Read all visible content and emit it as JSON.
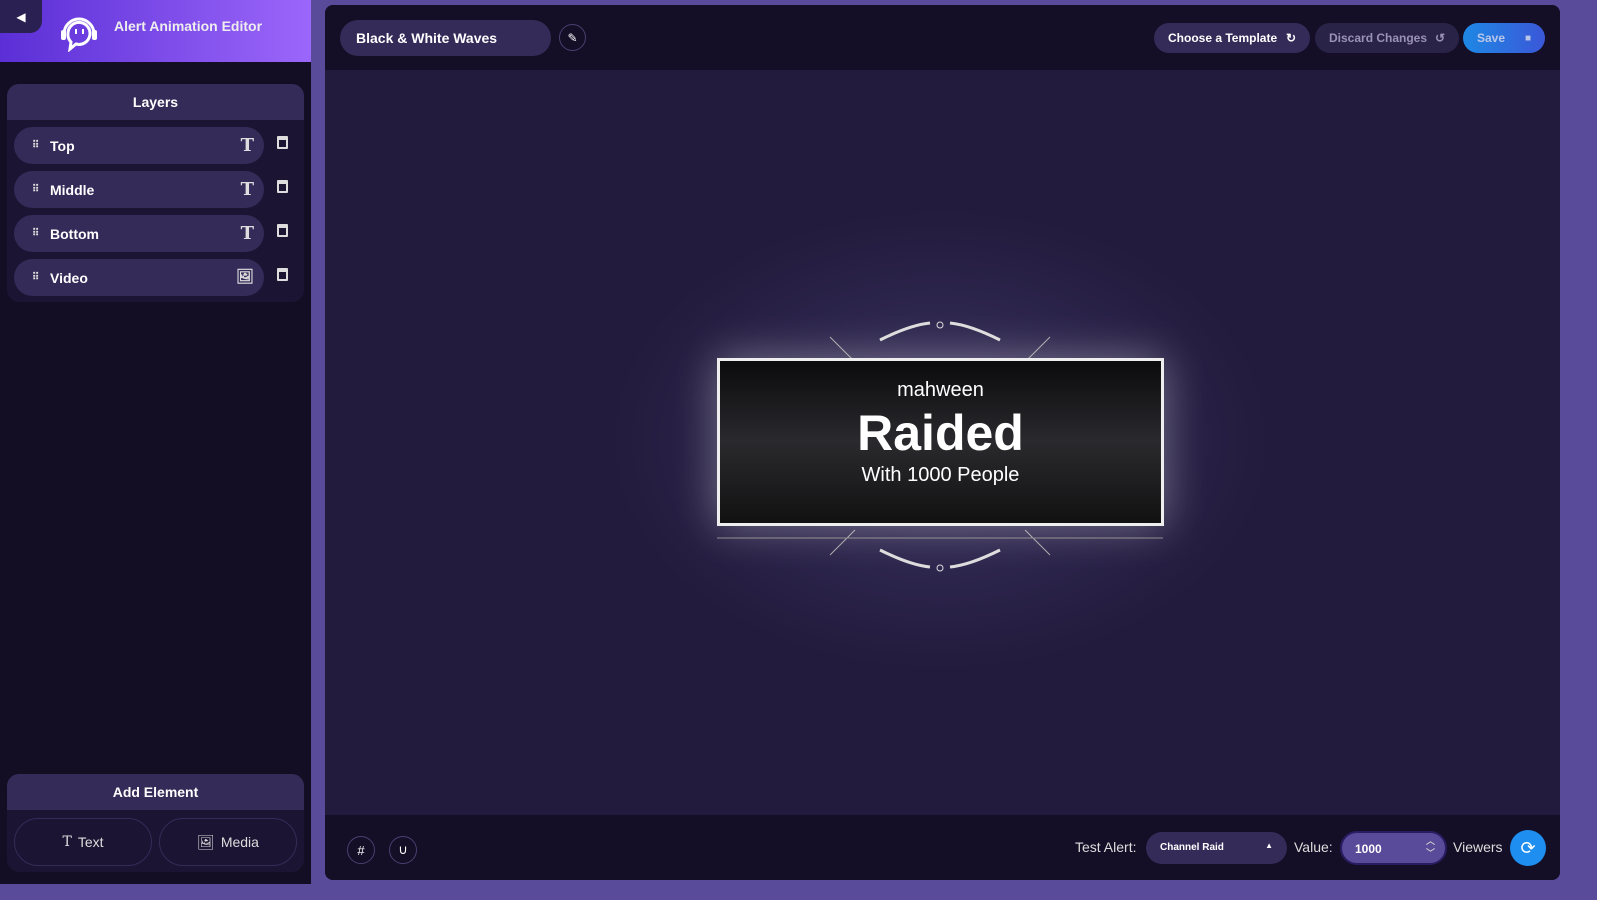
{
  "app": {
    "title": "Alert Animation Editor"
  },
  "layers": {
    "title": "Layers",
    "items": [
      {
        "label": "Top",
        "type_icon": "text-icon",
        "type_glyph": "T"
      },
      {
        "label": "Middle",
        "type_icon": "text-icon",
        "type_glyph": "T"
      },
      {
        "label": "Bottom",
        "type_icon": "text-icon",
        "type_glyph": "T"
      },
      {
        "label": "Video",
        "type_icon": "media-icon",
        "type_glyph": "🖼"
      }
    ]
  },
  "add_element": {
    "title": "Add Element",
    "text": "Text",
    "media": "Media"
  },
  "toolbar": {
    "template_name": "Black & White Waves",
    "choose_template": "Choose a Template",
    "discard": "Discard Changes",
    "save": "Save"
  },
  "preview": {
    "top": "mahween",
    "middle": "Raided",
    "bottom": "With 1000 People"
  },
  "footer": {
    "test_alert_label": "Test Alert:",
    "test_alert_value": "Channel Raid",
    "value_label": "Value:",
    "value": "1000",
    "unit": "Viewers"
  },
  "colors": {
    "accent": "#8b5cf6",
    "save": "#1e88e5"
  }
}
